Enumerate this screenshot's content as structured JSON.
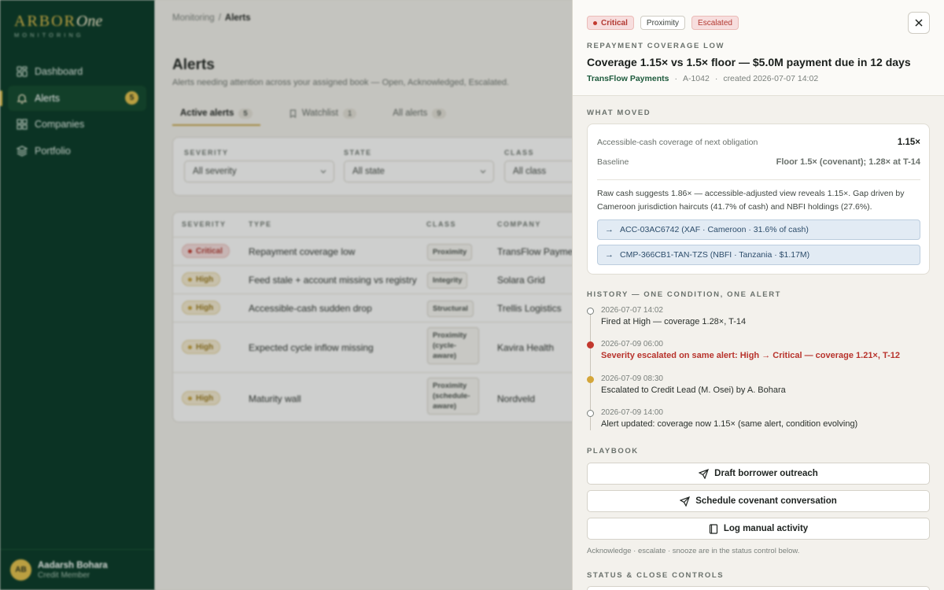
{
  "brand": {
    "name": "ARBOR",
    "suffix": "One",
    "sub": "MONITORING"
  },
  "sidebar": {
    "items": [
      {
        "label": "Dashboard",
        "icon": "dashboard-icon"
      },
      {
        "label": "Alerts",
        "icon": "bell-icon",
        "badge": "5",
        "active": true
      },
      {
        "label": "Companies",
        "icon": "grid-icon"
      },
      {
        "label": "Portfolio",
        "icon": "layers-icon"
      }
    ],
    "user": {
      "initials": "AB",
      "name": "Aadarsh Bohara",
      "role": "Credit Member"
    }
  },
  "breadcrumb": {
    "parent": "Monitoring",
    "sep": "/",
    "current": "Alerts"
  },
  "page": {
    "title": "Alerts",
    "subtitle": "Alerts needing attention across your assigned book — Open, Acknowledged, Escalated."
  },
  "tabs": [
    {
      "label": "Active alerts",
      "count": "5"
    },
    {
      "label": "Watchlist",
      "count": "1"
    },
    {
      "label": "All alerts",
      "count": "9"
    }
  ],
  "filters": [
    {
      "label": "SEVERITY",
      "value": "All severity"
    },
    {
      "label": "STATE",
      "value": "All state"
    },
    {
      "label": "CLASS",
      "value": "All class"
    }
  ],
  "table": {
    "headers": [
      "SEVERITY",
      "TYPE",
      "CLASS",
      "COMPANY"
    ],
    "rows": [
      {
        "severity": "Critical",
        "type": "Repayment coverage low",
        "class": "Proximity",
        "company": "TransFlow Payments"
      },
      {
        "severity": "High",
        "type": "Feed stale + account missing vs registry",
        "class": "Integrity",
        "company": "Solara Grid"
      },
      {
        "severity": "High",
        "type": "Accessible-cash sudden drop",
        "class": "Structural",
        "company": "Trellis Logistics"
      },
      {
        "severity": "High",
        "type": "Expected cycle inflow missing",
        "class": "Proximity (cycle-aware)",
        "company": "Kavira Health"
      },
      {
        "severity": "High",
        "type": "Maturity wall",
        "class": "Proximity (schedule-aware)",
        "company": "Nordveld"
      }
    ]
  },
  "drawer": {
    "pills": {
      "severity": "Critical",
      "class": "Proximity",
      "state": "Escalated"
    },
    "alert_type": "REPAYMENT COVERAGE LOW",
    "title": "Coverage 1.15× vs 1.5× floor — $5.0M payment due in 12 days",
    "company": "TransFlow Payments",
    "id": "A-1042",
    "created": "created 2026-07-07 14:02",
    "what_moved": {
      "label": "WHAT MOVED",
      "metric_label": "Accessible-cash coverage of next obligation",
      "metric_value": "1.15×",
      "baseline_label": "Baseline",
      "baseline_value": "Floor 1.5× (covenant); 1.28× at T-14",
      "explanation": "Raw cash suggests 1.86× — accessible-adjusted view reveals 1.15×. Gap driven by Cameroon jurisdiction haircuts (41.7% of cash) and NBFI holdings (27.6%).",
      "links": [
        "ACC-03AC6742 (XAF · Cameroon · 31.6% of cash)",
        "CMP-366CB1-TAN-TZS (NBFI · Tanzania · $1.17M)"
      ]
    },
    "history": {
      "label": "HISTORY — ONE CONDITION, ONE ALERT",
      "events": [
        {
          "time": "2026-07-07 14:02",
          "text": "Fired at High — coverage 1.28×, T-14"
        },
        {
          "time": "2026-07-09 06:00",
          "text": "Severity escalated on same alert: High → Critical — coverage 1.21×, T-12"
        },
        {
          "time": "2026-07-09 08:30",
          "text": "Escalated to Credit Lead (M. Osei) by A. Bohara"
        },
        {
          "time": "2026-07-09 14:00",
          "text": "Alert updated: coverage now 1.15× (same alert, condition evolving)"
        }
      ]
    },
    "playbook": {
      "label": "PLAYBOOK",
      "actions": [
        "Draft borrower outreach",
        "Schedule covenant conversation",
        "Log manual activity"
      ],
      "hint": "Acknowledge · escalate · snooze are in the status control below."
    },
    "status_label": "STATUS & CLOSE CONTROLS"
  },
  "colors": {
    "sidebar": "#0d3b29",
    "accent": "#d4b54a",
    "critical": "#c2392f",
    "high": "#d4a63a"
  }
}
